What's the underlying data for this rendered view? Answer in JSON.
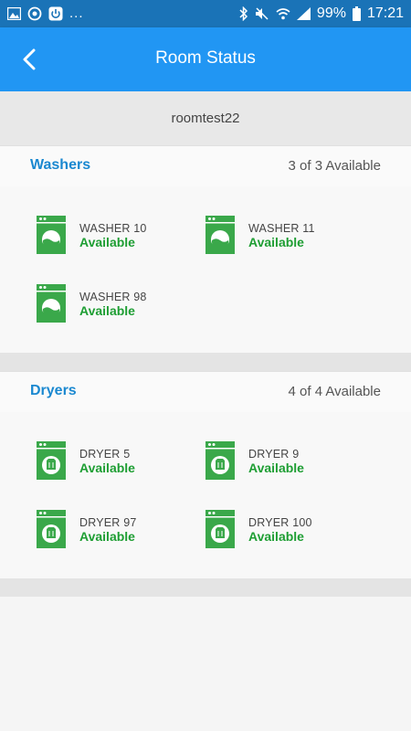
{
  "statusbar": {
    "time": "17:21",
    "battery": "99%",
    "dots": "..."
  },
  "appbar": {
    "title": "Room Status",
    "back_icon": "chevron-left-icon"
  },
  "room": {
    "name": "roomtest22"
  },
  "washers": {
    "title": "Washers",
    "count": "3 of 3 Available",
    "items": [
      {
        "name": "WASHER 10",
        "status": "Available"
      },
      {
        "name": "WASHER 11",
        "status": "Available"
      },
      {
        "name": "WASHER 98",
        "status": "Available"
      }
    ]
  },
  "dryers": {
    "title": "Dryers",
    "count": "4 of 4 Available",
    "items": [
      {
        "name": "DRYER 5",
        "status": "Available"
      },
      {
        "name": "DRYER 9",
        "status": "Available"
      },
      {
        "name": "DRYER 97",
        "status": "Available"
      },
      {
        "name": "DRYER 100",
        "status": "Available"
      }
    ]
  },
  "colors": {
    "appbar": "#2196f3",
    "statusbar": "#1a73b7",
    "section_title": "#1a88d0",
    "available": "#1e9e33",
    "machine_icon": "#3aa84a"
  }
}
